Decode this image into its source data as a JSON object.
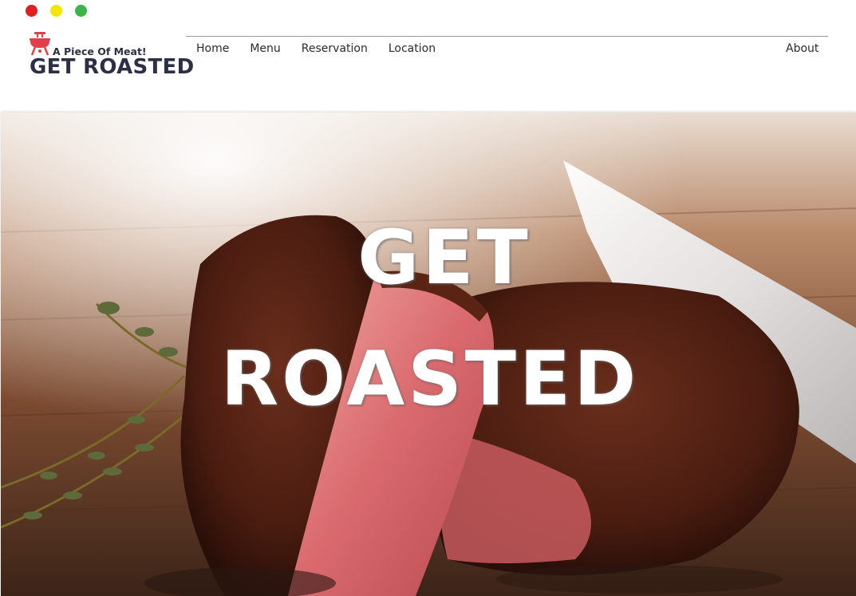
{
  "window": {
    "controls": [
      {
        "name": "close",
        "color": "#e02020"
      },
      {
        "name": "minimize",
        "color": "#f5e600"
      },
      {
        "name": "maximize",
        "color": "#3bb54a"
      }
    ]
  },
  "brand": {
    "tagline": "A Piece Of Meat!",
    "name": "GET ROASTED",
    "icon": "grill-icon",
    "icon_color": "#e0404a",
    "text_color": "#2d2f45"
  },
  "nav": {
    "items": [
      {
        "label": "Home"
      },
      {
        "label": "Menu"
      },
      {
        "label": "Reservation"
      },
      {
        "label": "Location"
      }
    ],
    "about": "About"
  },
  "hero": {
    "line1": "GET",
    "line2": "ROASTED",
    "image": "steak-on-cutting-board-photo"
  }
}
